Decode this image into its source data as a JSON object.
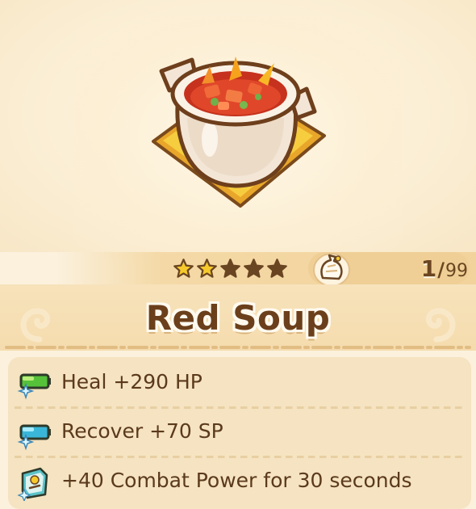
{
  "item": {
    "name": "Red Soup",
    "rarity_stars_total": 5,
    "rarity_stars_filled": 2,
    "inventory": {
      "have": "1",
      "separator": "/",
      "max": "99"
    }
  },
  "effects": [
    {
      "icon": "hp-potion-icon",
      "text": "Heal +290 HP"
    },
    {
      "icon": "sp-potion-icon",
      "text": "Recover +70 SP"
    },
    {
      "icon": "combat-power-icon",
      "text": "+40 Combat Power for 30 seconds"
    }
  ],
  "colors": {
    "title_text": "#6b3f1b",
    "body_text": "#5b3a1c",
    "star_filled": "#f6c92d",
    "star_empty": "#6a4522",
    "panel": "#f5e3c1",
    "background": "#fbf1dd"
  }
}
